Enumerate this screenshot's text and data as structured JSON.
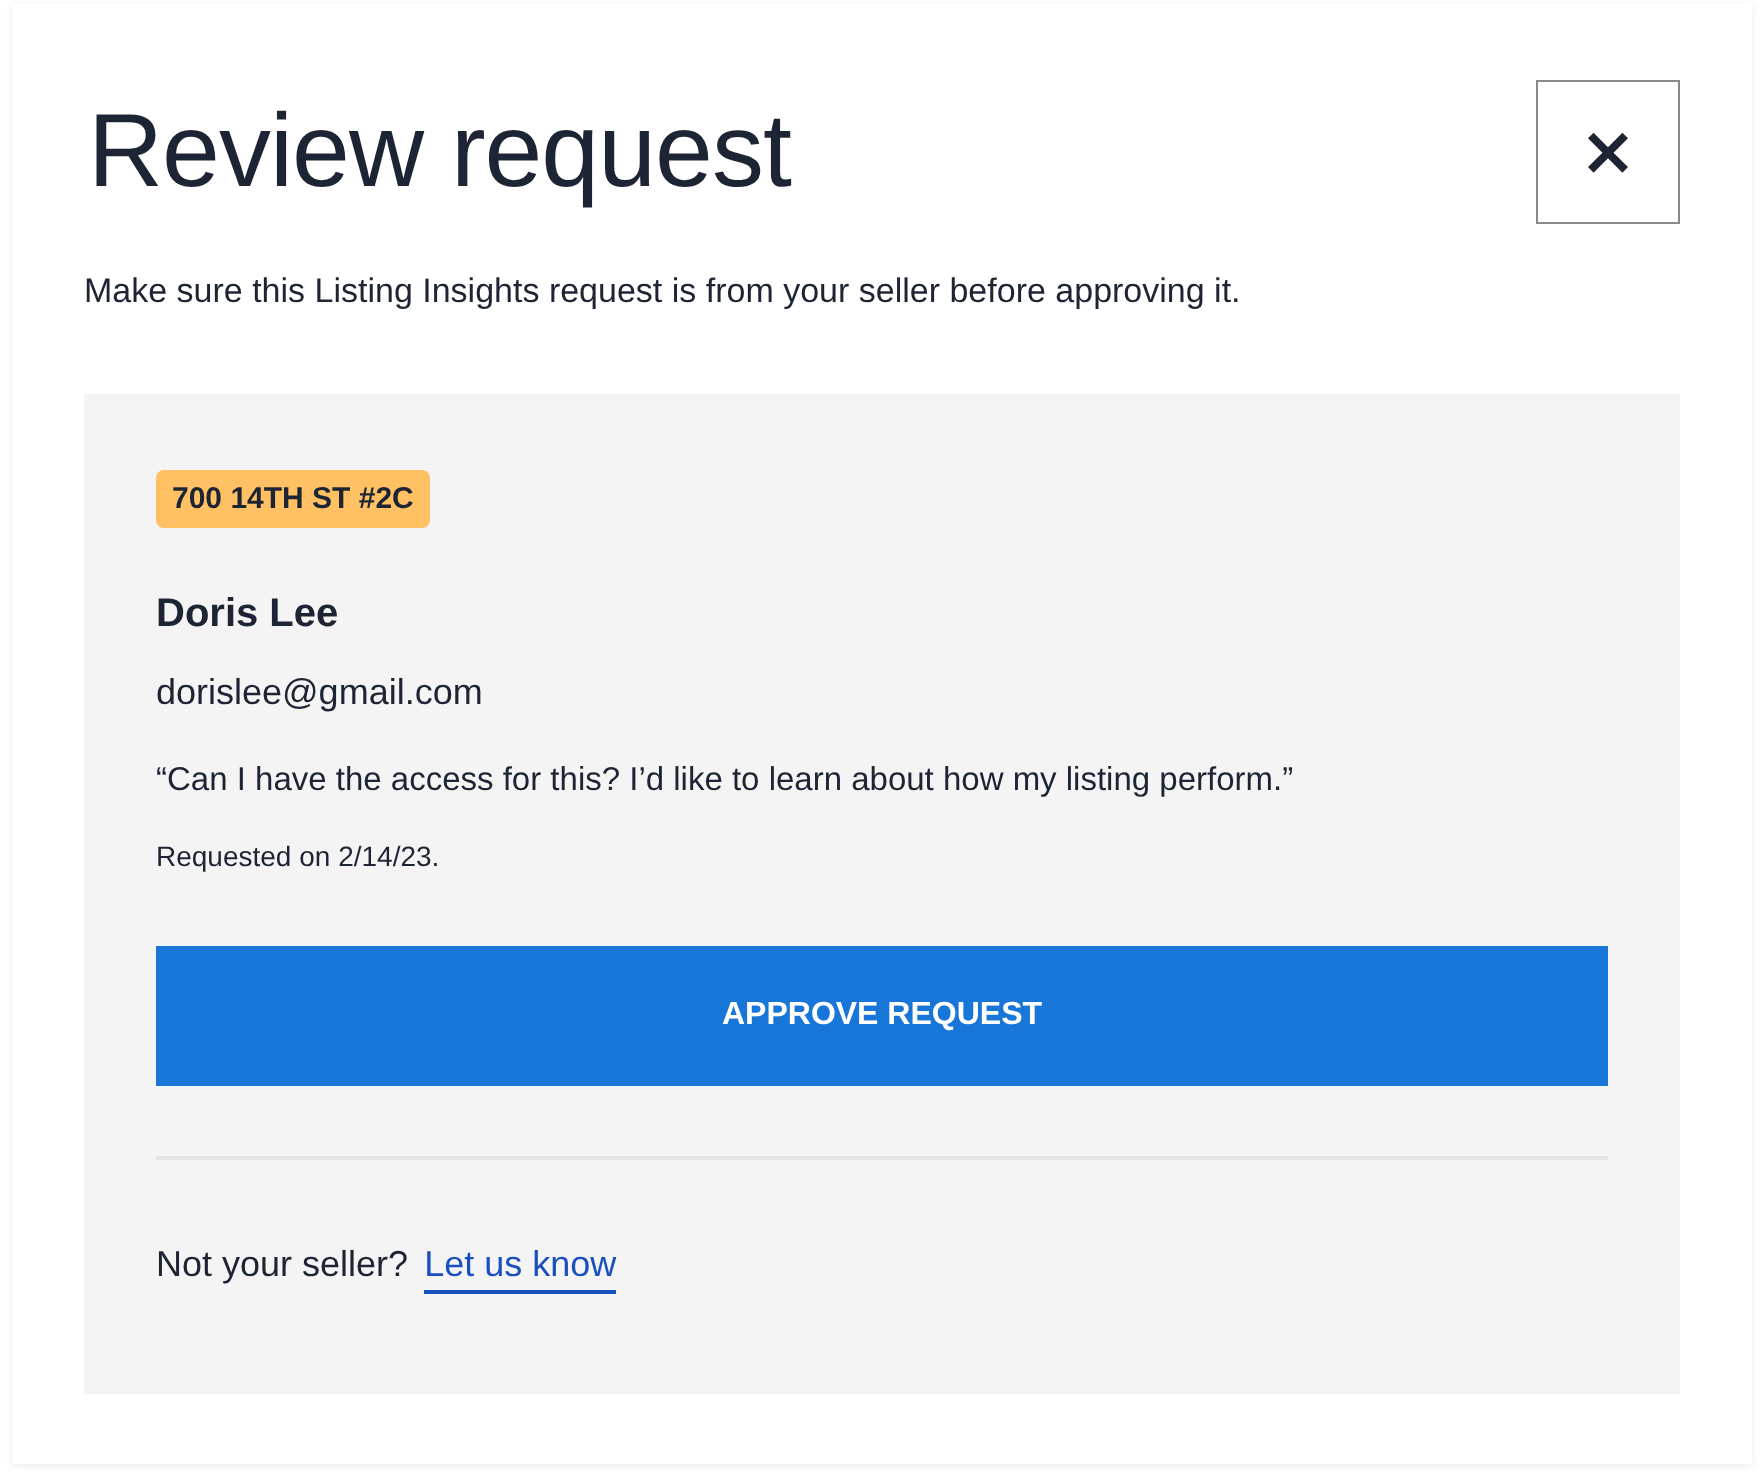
{
  "dialog": {
    "title": "Review request",
    "close_button": "×",
    "subtitle": "Make sure this Listing Insights request is from your seller before approving it."
  },
  "request": {
    "address_tag": "700 14TH ST #2C",
    "name": "Doris Lee",
    "email": "dorislee@gmail.com",
    "message": "“Can I have the access for this? I’d like to learn about how my listing perform.”",
    "requested_date": "Requested on 2/14/23.",
    "approve_button": "APPROVE REQUEST"
  },
  "footer": {
    "prompt": "Not your seller?",
    "link": "Let us know"
  }
}
